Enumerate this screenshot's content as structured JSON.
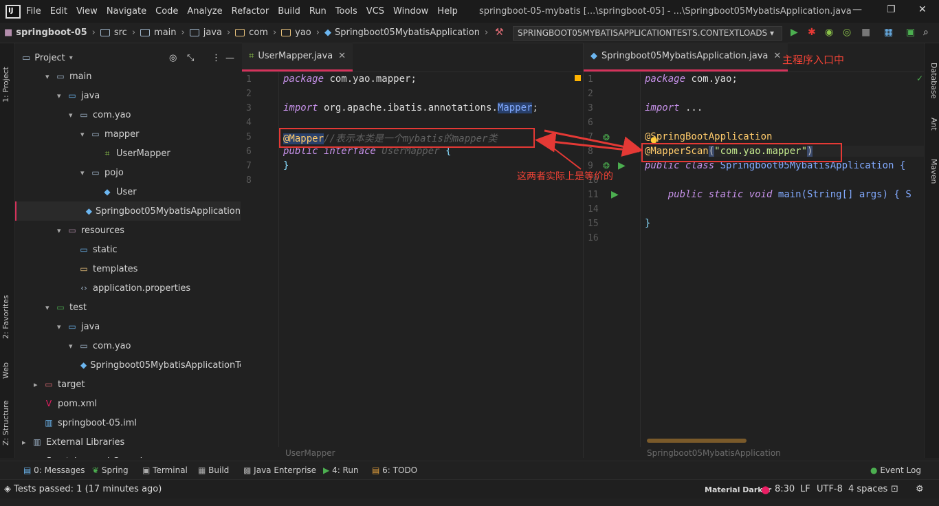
{
  "menubar": {
    "items": [
      "File",
      "Edit",
      "View",
      "Navigate",
      "Code",
      "Analyze",
      "Refactor",
      "Build",
      "Run",
      "Tools",
      "VCS",
      "Window",
      "Help"
    ],
    "window_title": "springboot-05-mybatis [...\\springboot-05] - ...\\Springboot05MybatisApplication.java"
  },
  "navbar": {
    "crumbs": [
      "springboot-05",
      "src",
      "main",
      "java",
      "com",
      "yao",
      "Springboot05MybatisApplication"
    ],
    "run_config": "SPRINGBOOT05MYBATISAPPLICATIONTESTS.CONTEXTLOADS"
  },
  "left_strip": {
    "project": "1: Project",
    "favorites": "2: Favorites",
    "web": "Web",
    "structure": "Z: Structure"
  },
  "right_strip": {
    "database": "Database",
    "ant": "Ant",
    "maven": "Maven"
  },
  "project": {
    "header": "Project",
    "tree": [
      {
        "label": "main",
        "indent": 2,
        "arrow": "▾",
        "icon": "folder"
      },
      {
        "label": "java",
        "indent": 3,
        "arrow": "▾",
        "icon": "folder-blue"
      },
      {
        "label": "com.yao",
        "indent": 4,
        "arrow": "▾",
        "icon": "folder"
      },
      {
        "label": "mapper",
        "indent": 5,
        "arrow": "▾",
        "icon": "folder"
      },
      {
        "label": "UserMapper",
        "indent": 6,
        "arrow": "",
        "icon": "mapper"
      },
      {
        "label": "pojo",
        "indent": 5,
        "arrow": "▾",
        "icon": "folder"
      },
      {
        "label": "User",
        "indent": 6,
        "arrow": "",
        "icon": "class"
      },
      {
        "label": "Springboot05MybatisApplication",
        "indent": 5,
        "arrow": "",
        "icon": "class",
        "selected": true
      },
      {
        "label": "resources",
        "indent": 3,
        "arrow": "▾",
        "icon": "folder-res"
      },
      {
        "label": "static",
        "indent": 4,
        "arrow": "",
        "icon": "folder-web"
      },
      {
        "label": "templates",
        "indent": 4,
        "arrow": "",
        "icon": "folder-yellow"
      },
      {
        "label": "application.properties",
        "indent": 4,
        "arrow": "",
        "icon": "props"
      },
      {
        "label": "test",
        "indent": 2,
        "arrow": "▾",
        "icon": "folder-green"
      },
      {
        "label": "java",
        "indent": 3,
        "arrow": "▾",
        "icon": "folder-blue"
      },
      {
        "label": "com.yao",
        "indent": 4,
        "arrow": "▾",
        "icon": "folder"
      },
      {
        "label": "Springboot05MybatisApplicationTe",
        "indent": 5,
        "arrow": "",
        "icon": "class"
      },
      {
        "label": "target",
        "indent": 1,
        "arrow": "▸",
        "icon": "folder-red"
      },
      {
        "label": "pom.xml",
        "indent": 1,
        "arrow": "",
        "icon": "maven"
      },
      {
        "label": "springboot-05.iml",
        "indent": 1,
        "arrow": "",
        "icon": "iml"
      },
      {
        "label": "External Libraries",
        "indent": 0,
        "arrow": "▸",
        "icon": "lib"
      },
      {
        "label": "Scratches and Consoles",
        "indent": 0,
        "arrow": "",
        "icon": "scratch"
      }
    ]
  },
  "editor_left": {
    "tab": "UserMapper.java",
    "breadcrumb": "UserMapper",
    "line_numbers": [
      "1",
      "2",
      "3",
      "4",
      "5",
      "6",
      "7",
      "8"
    ],
    "line1_kw": "package",
    "line1_rest": " com.yao.mapper;",
    "line3_kw": "import",
    "line3_rest": " org.apache.ibatis.annotations.",
    "line3_cls": "Mapper",
    "line3_end": ";",
    "line5_an": "@Mapper",
    "line5_cm": "//表示本类是一个mybatis的mapper类",
    "line6_kw1": "public",
    "line6_kw2": " interface",
    "line6_cls": " UserMapper",
    "line6_end": " {",
    "line7": "}"
  },
  "editor_right": {
    "tab": "Springboot05MybatisApplication.java",
    "breadcrumb": "Springboot05MybatisApplication",
    "line_numbers": [
      "1",
      "2",
      "3",
      "6",
      "7",
      "8",
      "9",
      "10",
      "11",
      "14",
      "15",
      "16"
    ],
    "line1_kw": "package",
    "line1_rest": " com.yao;",
    "line3_kw": "import",
    "line3_rest": " ...",
    "line7": "@SpringBootApplication",
    "line8_an": "@MapperScan",
    "line8_open": "(",
    "line8_str": "\"com.yao.mapper\"",
    "line8_close": ")",
    "line9_kw1": "public",
    "line9_kw2": " class",
    "line9_rest": " Springboot05MybatisApplication {",
    "line11_kw1": "public",
    "line11_kw2": " static",
    "line11_kw3": " void",
    "line11_rest": " main(String[] args) { S",
    "line15": "}"
  },
  "annotations": {
    "main_entry": "主程序入口中",
    "equivalent": "这两者实际上是等价的"
  },
  "bottom_tools": [
    "0: Messages",
    "Spring",
    "Terminal",
    "Build",
    "Java Enterprise",
    "4: Run",
    "6: TODO",
    "Event Log"
  ],
  "status": {
    "message": "Tests passed: 1 (17 minutes ago)",
    "theme": "Material Darker",
    "position": "8:30",
    "line_sep": "LF",
    "encoding": "UTF-8",
    "indent": "4 spaces"
  },
  "colors": {
    "accent": "#d5325b",
    "annotation_red": "#e53935",
    "keyword": "#c792ea",
    "string": "#c3e88d",
    "annotation": "#ffcb6b"
  }
}
